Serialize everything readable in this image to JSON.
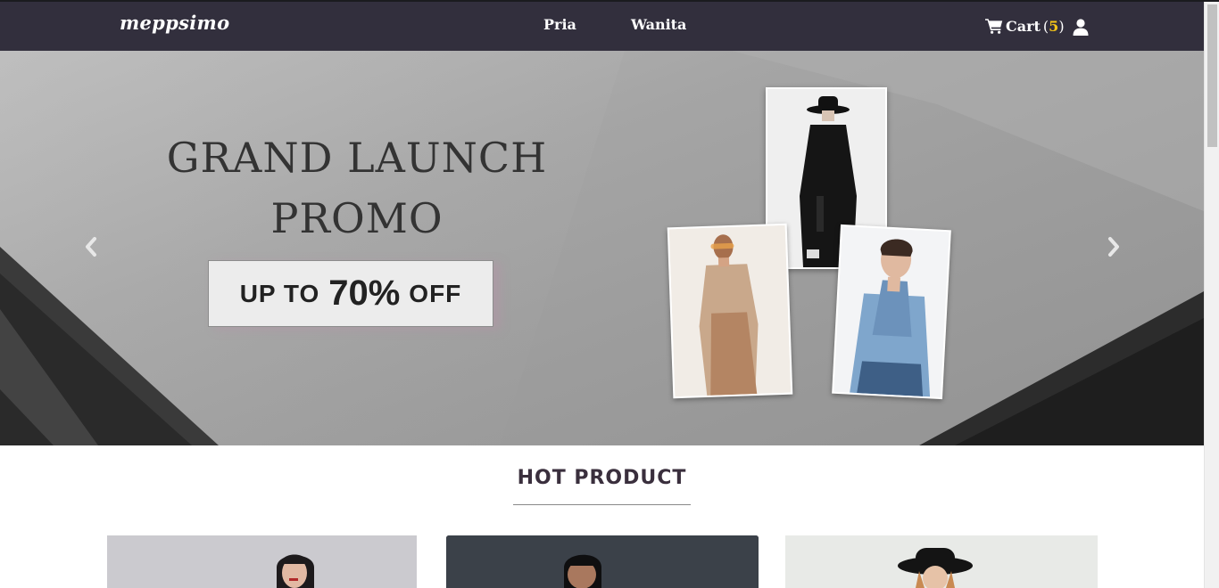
{
  "navbar": {
    "brand": "meppsimo",
    "links": [
      "Pria",
      "Wanita"
    ],
    "cart_label": "Cart",
    "cart_count": "5",
    "colors": {
      "background": "#322f3d",
      "cart_count": "#f5c518"
    }
  },
  "hero": {
    "title_line1": "GRAND LAUNCH",
    "title_line2": "PROMO",
    "promo_prefix": "UP TO",
    "promo_value": "70%",
    "promo_suffix": "OFF",
    "prev_icon": "chevron-left-icon",
    "next_icon": "chevron-right-icon"
  },
  "hot_product": {
    "title": "HOT PRODUCT",
    "cards": [
      {
        "name": "product-card-1"
      },
      {
        "name": "product-card-2"
      },
      {
        "name": "product-card-3"
      }
    ]
  },
  "icons": {
    "cart": "cart-icon",
    "user": "user-icon"
  }
}
